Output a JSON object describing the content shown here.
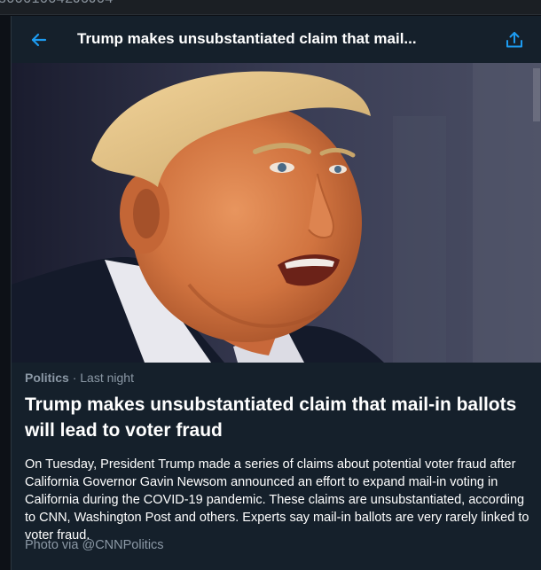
{
  "window": {
    "clipped_text": "300010042J0J04"
  },
  "header": {
    "back_icon": "arrow-left-icon",
    "title": "Trump makes unsubstantiated claim that mail...",
    "share_icon": "share-upload-icon",
    "accent_color": "#1d9bf0"
  },
  "article": {
    "category": "Politics",
    "separator": "·",
    "time": "Last night",
    "headline": "Trump makes unsubstantiated claim that mail-in ballots will lead to voter fraud",
    "summary": "On Tuesday, President Trump made a series of claims about potential voter fraud after California Governor Gavin Newsom announced an effort to expand mail-in voting in California during the COVID-19 pandemic. These claims are unsubstantiated, according to CNN, Washington Post and others. Experts say mail-in ballots are very rarely linked to voter fraud.",
    "photo_credit": "Photo via @CNNPolitics"
  }
}
